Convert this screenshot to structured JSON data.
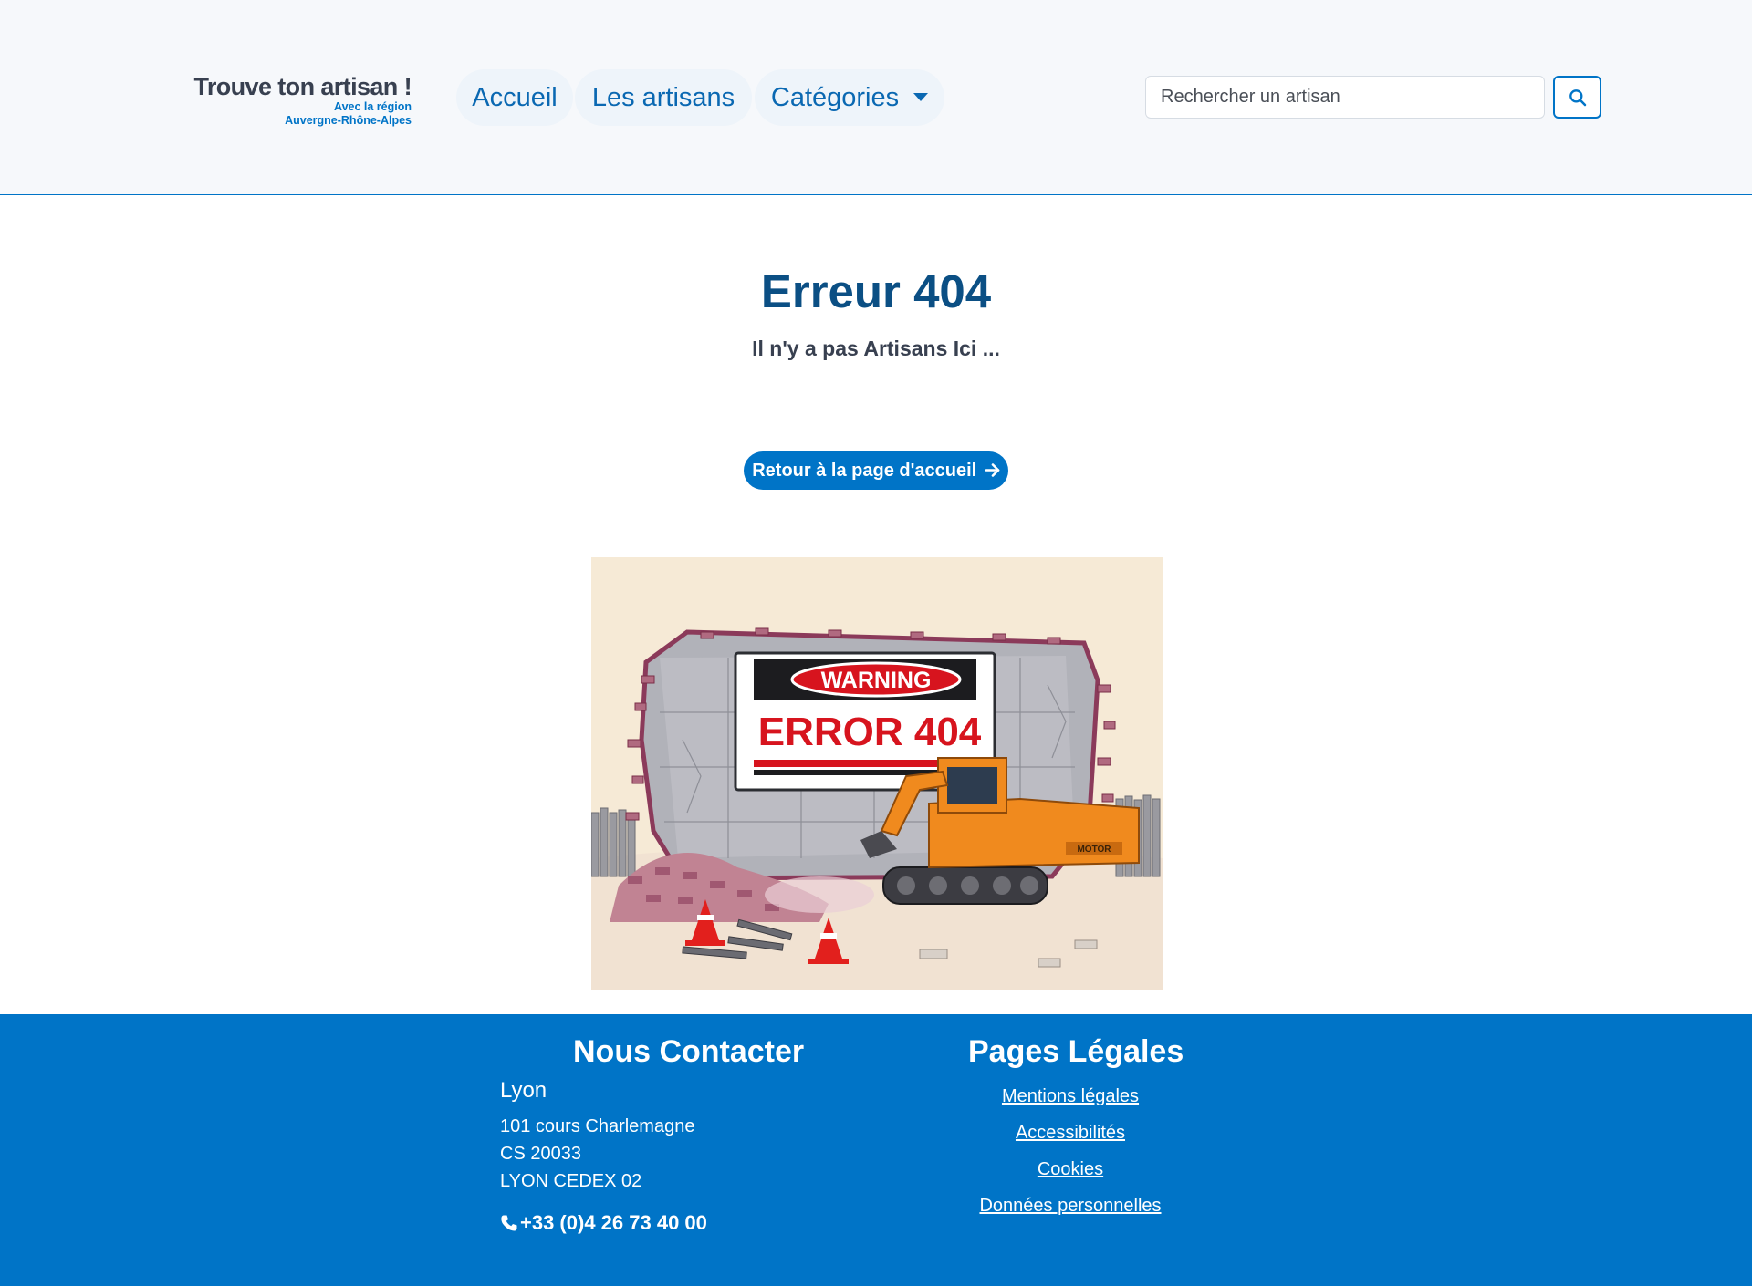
{
  "header": {
    "logo_title": "Trouve ton artisan !",
    "logo_sub1": "Avec la région",
    "logo_sub2": "Auvergne-Rhône-Alpes",
    "nav": [
      {
        "label": "Accueil"
      },
      {
        "label": "Les artisans"
      },
      {
        "label": "Catégories"
      }
    ],
    "search": {
      "placeholder": "Rechercher un artisan",
      "icon": "search-icon"
    }
  },
  "main": {
    "title": "Erreur 404",
    "subtitle": "Il n'y a pas Artisans Ici ...",
    "home_button": "Retour à la page d'accueil",
    "home_button_icon": "arrow-right-icon",
    "illustration": {
      "sign_top": "WARNING",
      "sign_main": "ERROR 404",
      "machine_label": "MOTOR"
    }
  },
  "footer": {
    "contact_title": "Nous Contacter",
    "city": "Lyon",
    "address": [
      "101 cours Charlemagne",
      "CS 20033",
      "LYON CEDEX 02"
    ],
    "phone": "+33 (0)4 26 73 40 00",
    "phone_icon": "phone-icon",
    "legal_title": "Pages Légales",
    "legal_links": [
      "Mentions légales",
      "Accessibilités",
      "Cookies",
      "Données personnelles"
    ]
  },
  "colors": {
    "brand_blue": "#0074c7",
    "title_navy": "#0b4f84",
    "header_bg": "#f6f8fb",
    "text_dark": "#384050"
  }
}
